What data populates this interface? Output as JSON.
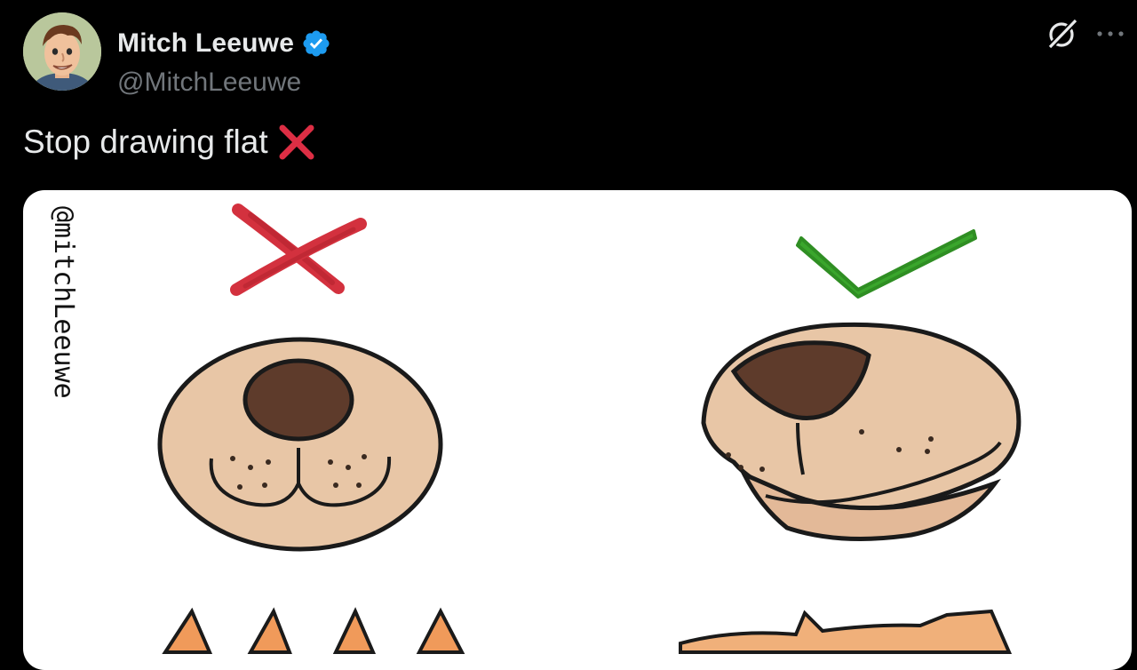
{
  "tweet": {
    "author": {
      "display_name": "Mitch Leeuwe",
      "handle": "@MitchLeeuwe",
      "verified": true,
      "avatar_icon": "cartoon-man-avatar"
    },
    "text": "Stop drawing flat",
    "text_emoji": "cross-mark-emoji",
    "media": {
      "watermark": "@mitchLeeuwe",
      "panels": [
        {
          "mark": "red-x",
          "subject": "flat dog snout"
        },
        {
          "mark": "green-check",
          "subject": "3d dog snout"
        }
      ]
    }
  },
  "colors": {
    "background": "#000000",
    "text_primary": "#e7e9ea",
    "text_secondary": "#71767b",
    "verified_blue": "#1d9bf0",
    "cross_red": "#d3313e",
    "check_green": "#3aa62c",
    "snout_tan": "#e8c6a6",
    "nose_brown": "#5e3b2b"
  }
}
